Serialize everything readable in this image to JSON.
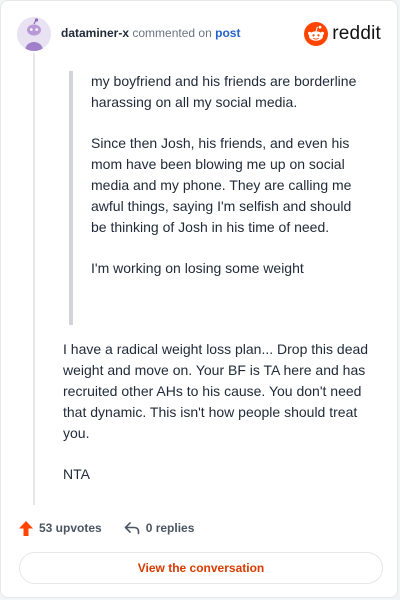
{
  "header": {
    "username": "dataminer-x",
    "action_text": "commented on",
    "post_link": "post",
    "logo_text": "reddit"
  },
  "quote": {
    "paragraphs": [
      "my boyfriend and his friends are borderline harassing on all my social media.",
      "Since then Josh, his friends, and even his mom have been blowing me up on social media and my phone. They are calling me awful things, saying I'm selfish and should be thinking of Josh in his time of need.",
      "I'm working on losing some weight"
    ]
  },
  "reply": {
    "paragraphs": [
      "I have a radical weight loss plan... Drop this dead weight and move on. Your BF is TA here and has recruited other AHs to his cause. You don't need that dynamic. This isn't how people should treat you.",
      "NTA"
    ]
  },
  "footer": {
    "upvotes": "53 upvotes",
    "replies": "0 replies",
    "cta": "View the conversation"
  },
  "colors": {
    "brand": "#ff4500",
    "link": "#2563c9",
    "cta_text": "#d93a00"
  }
}
